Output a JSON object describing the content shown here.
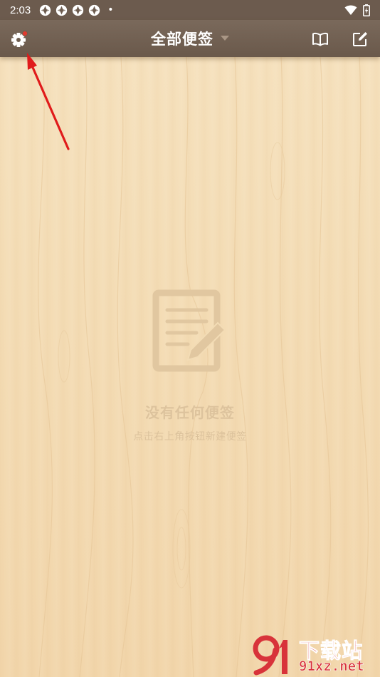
{
  "status_bar": {
    "time": "2:03",
    "notification_icons": [
      "app-notification-icon",
      "app-notification-icon",
      "app-notification-icon",
      "app-notification-icon"
    ],
    "dot": "•",
    "right_icons": [
      "wifi-icon",
      "battery-charging-icon"
    ]
  },
  "app_bar": {
    "title": "全部便签",
    "settings_has_badge": true,
    "actions": [
      "book-icon",
      "compose-icon"
    ]
  },
  "empty_state": {
    "title": "没有任何便签",
    "hint": "点击右上角按钮新建便签"
  },
  "watermark": {
    "name": "下载站",
    "url": "91xz.net"
  },
  "colors": {
    "app_bar": "#6c5b4e",
    "background": "#f4ddb6",
    "badge": "#e03a2f",
    "annotation": "#e01b1b",
    "watermark": "#d8333a"
  }
}
